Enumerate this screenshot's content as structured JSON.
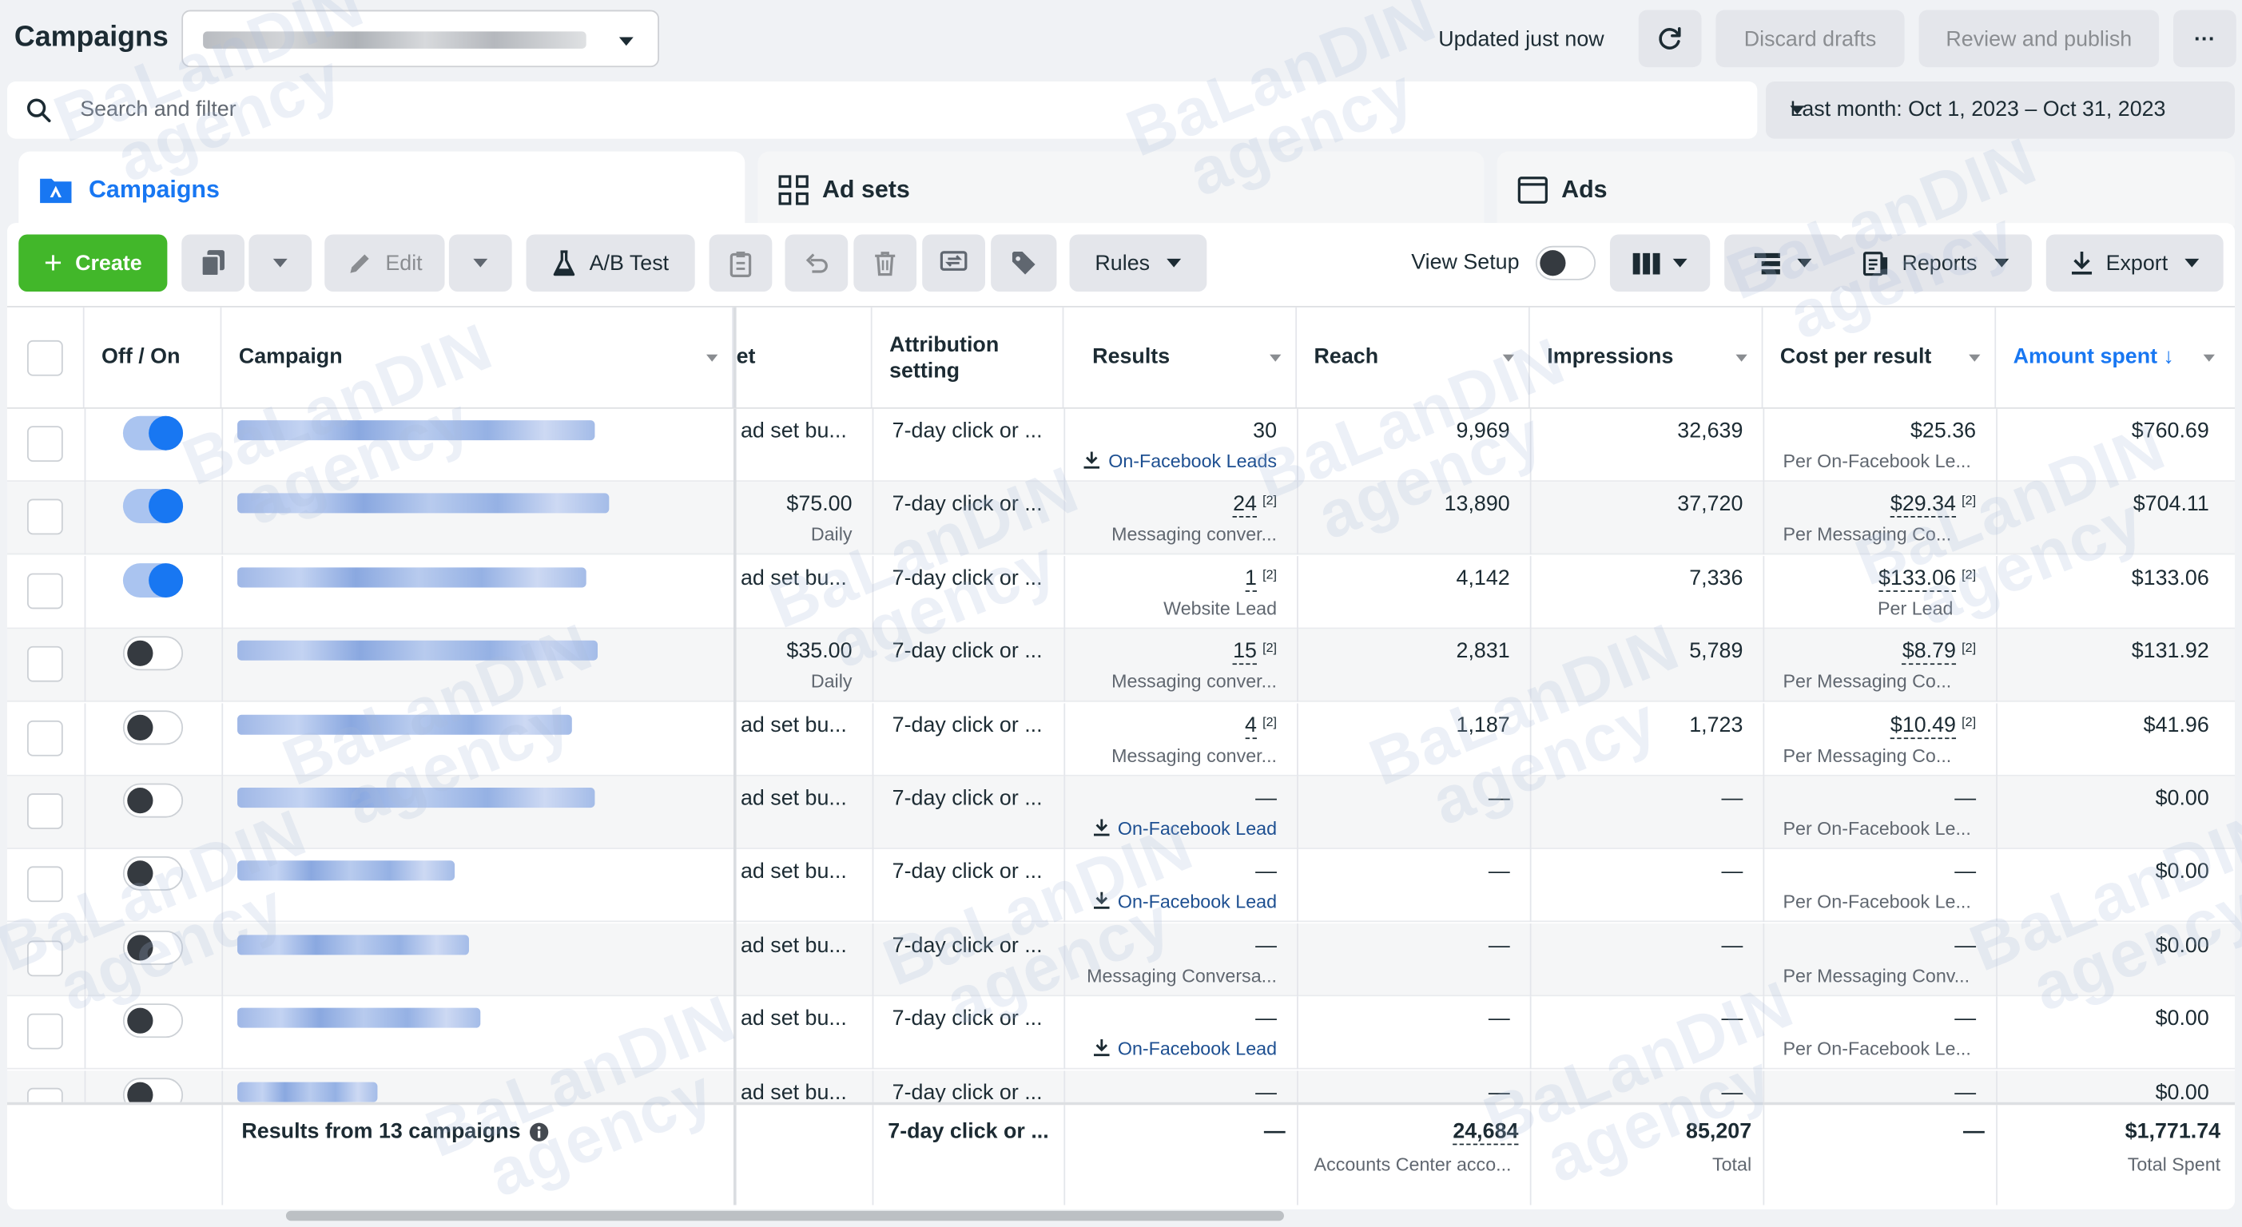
{
  "topbar": {
    "title": "Campaigns",
    "updated": "Updated just now",
    "discard": "Discard drafts",
    "review": "Review and publish",
    "more": "···"
  },
  "search": {
    "placeholder": "Search and filter",
    "date_range": "Last month: Oct 1, 2023 – Oct 31, 2023"
  },
  "tabs": [
    {
      "label": "Campaigns",
      "active": true
    },
    {
      "label": "Ad sets",
      "active": false
    },
    {
      "label": "Ads",
      "active": false
    }
  ],
  "toolbar": {
    "create": "Create",
    "edit": "Edit",
    "ab_test": "A/B Test",
    "rules": "Rules",
    "view_setup": "View Setup",
    "reports": "Reports",
    "export": "Export"
  },
  "table": {
    "headers": {
      "off_on": "Off / On",
      "campaign": "Campaign",
      "budget": "et",
      "attribution": "Attribution setting",
      "results": "Results",
      "reach": "Reach",
      "impressions": "Impressions",
      "cost_per_result": "Cost per result",
      "amount_spent": "Amount spent ↓"
    },
    "rows": [
      {
        "on": true,
        "budget": "ad set bu...",
        "budget_sub": "",
        "attribution": "7-day click or ...",
        "results": "30",
        "results_note": "",
        "results_sub": "On-Facebook Leads",
        "results_link": true,
        "reach": "9,969",
        "impressions": "32,639",
        "cpr": "$25.36",
        "cpr_note": "",
        "cpr_sub": "Per On-Facebook Le...",
        "spent": "$760.69"
      },
      {
        "on": true,
        "budget": "$75.00",
        "budget_sub": "Daily",
        "attribution": "7-day click or ...",
        "results": "24",
        "results_note": "[2]",
        "results_sub": "Messaging conver...",
        "results_link": false,
        "reach": "13,890",
        "impressions": "37,720",
        "cpr": "$29.34",
        "cpr_note": "[2]",
        "cpr_sub": "Per Messaging Co...",
        "spent": "$704.11"
      },
      {
        "on": true,
        "budget": "ad set bu...",
        "budget_sub": "",
        "attribution": "7-day click or ...",
        "results": "1",
        "results_note": "[2]",
        "results_sub": "Website Lead",
        "results_link": false,
        "reach": "4,142",
        "impressions": "7,336",
        "cpr": "$133.06",
        "cpr_note": "[2]",
        "cpr_sub": "Per Lead",
        "spent": "$133.06"
      },
      {
        "on": false,
        "budget": "$35.00",
        "budget_sub": "Daily",
        "attribution": "7-day click or ...",
        "results": "15",
        "results_note": "[2]",
        "results_sub": "Messaging conver...",
        "results_link": false,
        "reach": "2,831",
        "impressions": "5,789",
        "cpr": "$8.79",
        "cpr_note": "[2]",
        "cpr_sub": "Per Messaging Co...",
        "spent": "$131.92"
      },
      {
        "on": false,
        "budget": "ad set bu...",
        "budget_sub": "",
        "attribution": "7-day click or ...",
        "results": "4",
        "results_note": "[2]",
        "results_sub": "Messaging conver...",
        "results_link": false,
        "reach": "1,187",
        "impressions": "1,723",
        "cpr": "$10.49",
        "cpr_note": "[2]",
        "cpr_sub": "Per Messaging Co...",
        "spent": "$41.96"
      },
      {
        "on": false,
        "budget": "ad set bu...",
        "budget_sub": "",
        "attribution": "7-day click or ...",
        "results": "—",
        "results_note": "",
        "results_sub": "On-Facebook Lead",
        "results_link": true,
        "reach": "—",
        "impressions": "—",
        "cpr": "—",
        "cpr_note": "",
        "cpr_sub": "Per On-Facebook Le...",
        "spent": "$0.00"
      },
      {
        "on": false,
        "budget": "ad set bu...",
        "budget_sub": "",
        "attribution": "7-day click or ...",
        "results": "—",
        "results_note": "",
        "results_sub": "On-Facebook Lead",
        "results_link": true,
        "reach": "—",
        "impressions": "—",
        "cpr": "—",
        "cpr_note": "",
        "cpr_sub": "Per On-Facebook Le...",
        "spent": "$0.00"
      },
      {
        "on": false,
        "budget": "ad set bu...",
        "budget_sub": "",
        "attribution": "7-day click or ...",
        "results": "—",
        "results_note": "",
        "results_sub": "Messaging Conversa...",
        "results_link": false,
        "reach": "—",
        "impressions": "—",
        "cpr": "—",
        "cpr_note": "",
        "cpr_sub": "Per Messaging Conv...",
        "spent": "$0.00"
      },
      {
        "on": false,
        "budget": "ad set bu...",
        "budget_sub": "",
        "attribution": "7-day click or ...",
        "results": "—",
        "results_note": "",
        "results_sub": "On-Facebook Lead",
        "results_link": true,
        "reach": "—",
        "impressions": "—",
        "cpr": "—",
        "cpr_note": "",
        "cpr_sub": "Per On-Facebook Le...",
        "spent": "$0.00"
      },
      {
        "on": false,
        "budget": "ad set bu...",
        "budget_sub": "",
        "attribution": "7-day click or ...",
        "results": "—",
        "results_note": "",
        "results_sub": "",
        "results_link": false,
        "reach": "—",
        "impressions": "—",
        "cpr": "—",
        "cpr_note": "",
        "cpr_sub": "",
        "spent": "$0.00"
      }
    ],
    "footer": {
      "label": "Results from 13 campaigns",
      "attribution": "7-day click or ...",
      "results": "—",
      "reach": "24,684",
      "reach_sub": "Accounts Center acco...",
      "impressions": "85,207",
      "impressions_sub": "Total",
      "cpr": "—",
      "spent": "$1,771.74",
      "spent_sub": "Total Spent"
    }
  },
  "watermark": {
    "line1": "BaLanDIN",
    "line2": "agency"
  },
  "colors": {
    "accent": "#1877f2",
    "create": "#42b72a",
    "link": "#1d4f91"
  }
}
